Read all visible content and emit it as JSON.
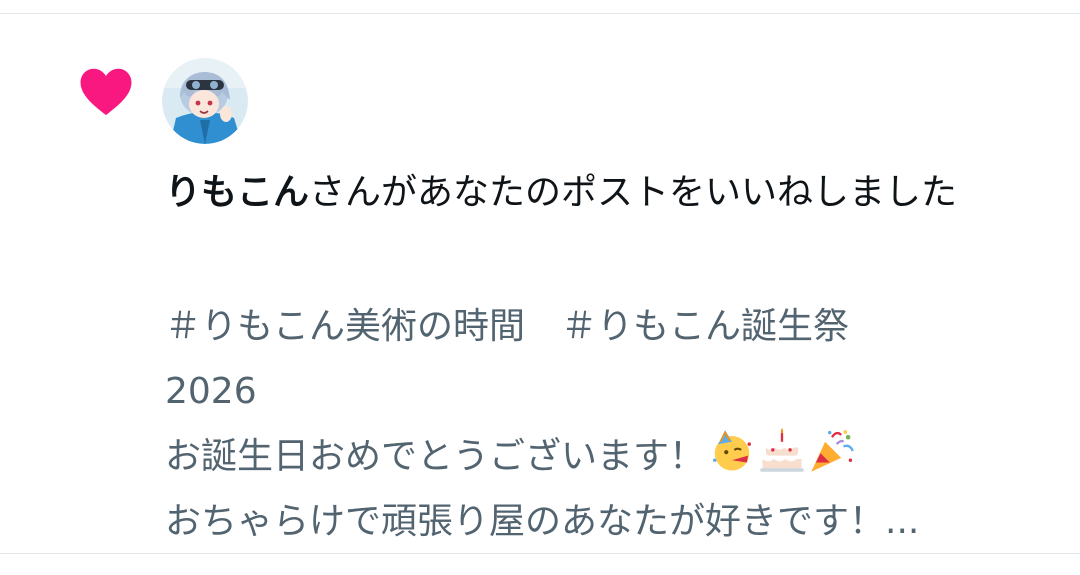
{
  "colors": {
    "heart": "#f91880",
    "primary_text": "#0f1419",
    "secondary_text": "#536471",
    "divider": "#e3e6e9"
  },
  "notification": {
    "type_icon": "heart-icon",
    "username": "りもこん",
    "action_text": "さんがあなたのポストをいいねしました",
    "post_preview": {
      "line1": "＃りもこん美術の時間　＃りもこん誕生祭",
      "line2": "2026",
      "line3": "お誕生日おめでとうございます！",
      "line3_emojis": [
        "partying-face-emoji",
        "birthday-cake-emoji",
        "party-popper-emoji"
      ],
      "line4": "おちゃらけで頑張り屋のあなたが好きです！..."
    }
  }
}
